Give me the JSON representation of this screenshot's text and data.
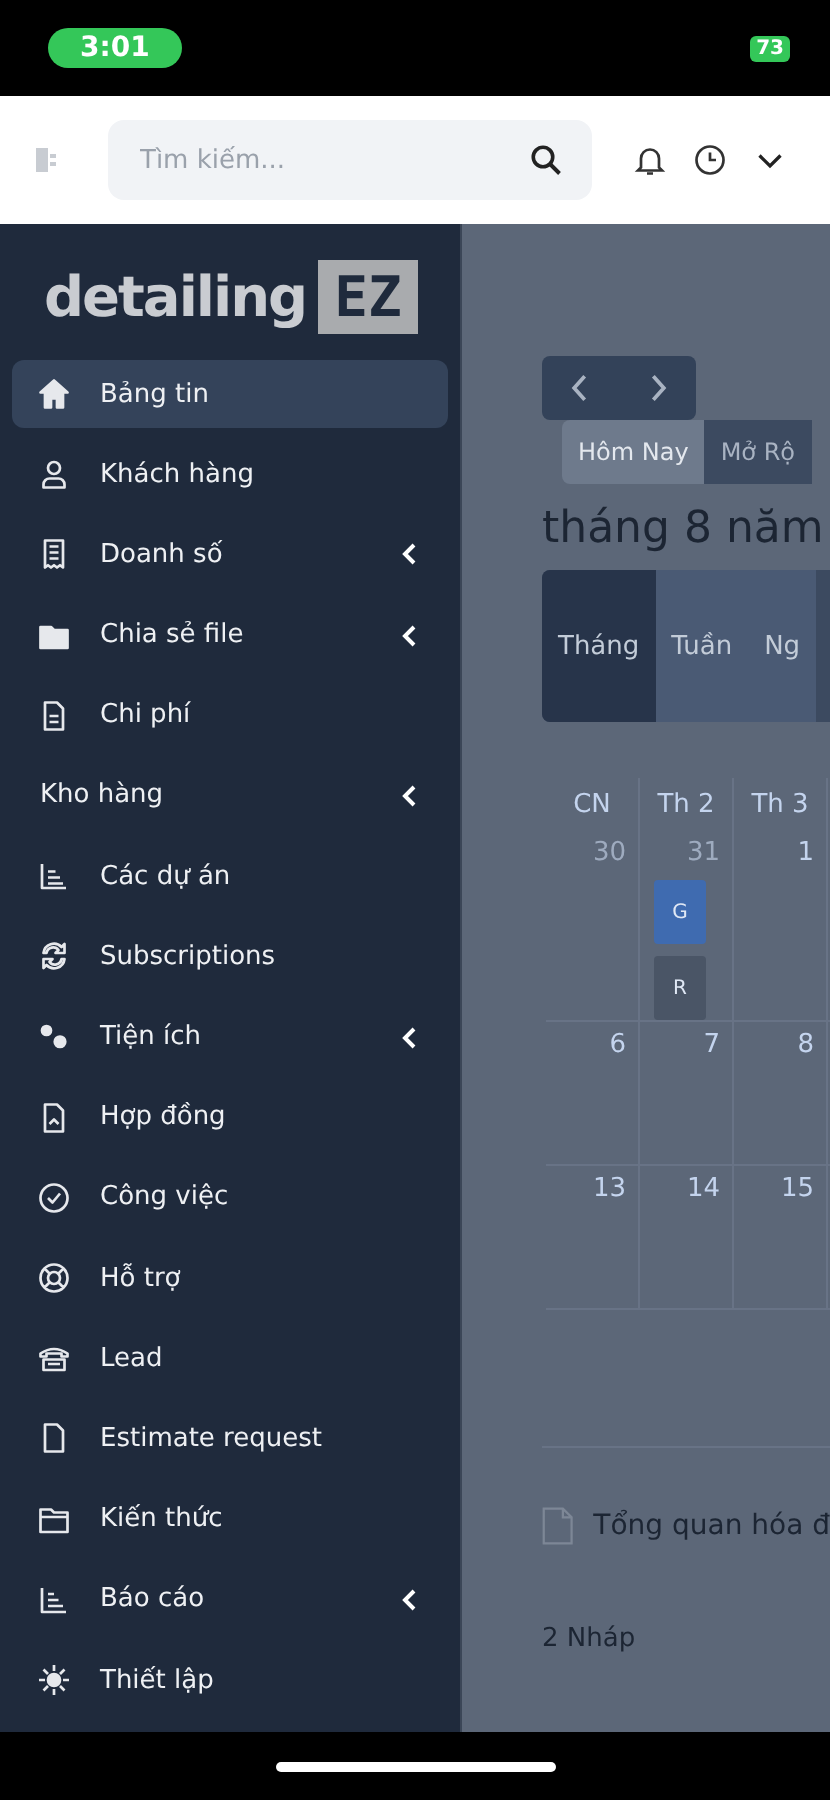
{
  "status_bar": {
    "time": "3:01",
    "battery": "73"
  },
  "header": {
    "search": {
      "placeholder": "Tìm kiếm..."
    }
  },
  "sidebar": {
    "logo": {
      "word": "detailing",
      "badge": "EZ"
    },
    "items": [
      {
        "kind": "link",
        "label": "Bảng tin",
        "selected": true,
        "expandable": false
      },
      {
        "kind": "link",
        "label": "Khách hàng",
        "selected": false,
        "expandable": false
      },
      {
        "kind": "link",
        "label": "Doanh số",
        "selected": false,
        "expandable": true
      },
      {
        "kind": "link",
        "label": "Chia sẻ file",
        "selected": false,
        "expandable": true
      },
      {
        "kind": "link",
        "label": "Chi phí",
        "selected": false,
        "expandable": false
      },
      {
        "kind": "heading",
        "label": "Kho hàng",
        "selected": false,
        "expandable": true
      },
      {
        "kind": "link",
        "label": "Các dự án",
        "selected": false,
        "expandable": false
      },
      {
        "kind": "link",
        "label": "Subscriptions",
        "selected": false,
        "expandable": false
      },
      {
        "kind": "link",
        "label": "Tiện ích",
        "selected": false,
        "expandable": true
      },
      {
        "kind": "link",
        "label": "Hợp đồng",
        "selected": false,
        "expandable": false
      },
      {
        "kind": "link",
        "label": "Công việc",
        "selected": false,
        "expandable": false
      },
      {
        "kind": "link",
        "label": "Hỗ trợ",
        "selected": false,
        "expandable": false
      },
      {
        "kind": "link",
        "label": "Lead",
        "selected": false,
        "expandable": false
      },
      {
        "kind": "link",
        "label": "Estimate request",
        "selected": false,
        "expandable": false
      },
      {
        "kind": "link",
        "label": "Kiến thức",
        "selected": false,
        "expandable": false
      },
      {
        "kind": "link",
        "label": "Báo cáo",
        "selected": false,
        "expandable": true
      },
      {
        "kind": "link",
        "label": "Thiết lập",
        "selected": false,
        "expandable": false
      }
    ]
  },
  "calendar": {
    "nav": [
      "Hôm Nay",
      "Mở Rộ"
    ],
    "title": "tháng 8 năm",
    "views": [
      {
        "label": "Tháng",
        "selected": true
      },
      {
        "label": "Tuần",
        "selected": false
      },
      {
        "label": "Ng",
        "selected": false
      }
    ],
    "weekdays": [
      "CN",
      "Th 2",
      "Th 3"
    ],
    "weeks": [
      [
        {
          "day": "30",
          "other_month": true
        },
        {
          "day": "31",
          "other_month": true,
          "events": [
            {
              "label": "G",
              "color": "#3f6bb0"
            },
            {
              "label": "R",
              "color": "#4a5566"
            }
          ]
        },
        {
          "day": "1",
          "other_month": false
        }
      ],
      [
        {
          "day": "6",
          "other_month": false
        },
        {
          "day": "7",
          "other_month": false
        },
        {
          "day": "8",
          "other_month": false
        }
      ],
      [
        {
          "day": "13",
          "other_month": false
        },
        {
          "day": "14",
          "other_month": false
        },
        {
          "day": "15",
          "other_month": false
        }
      ]
    ]
  },
  "invoices": {
    "title": "Tổng quan hóa đ",
    "lines": [
      "2 Nháp"
    ]
  }
}
